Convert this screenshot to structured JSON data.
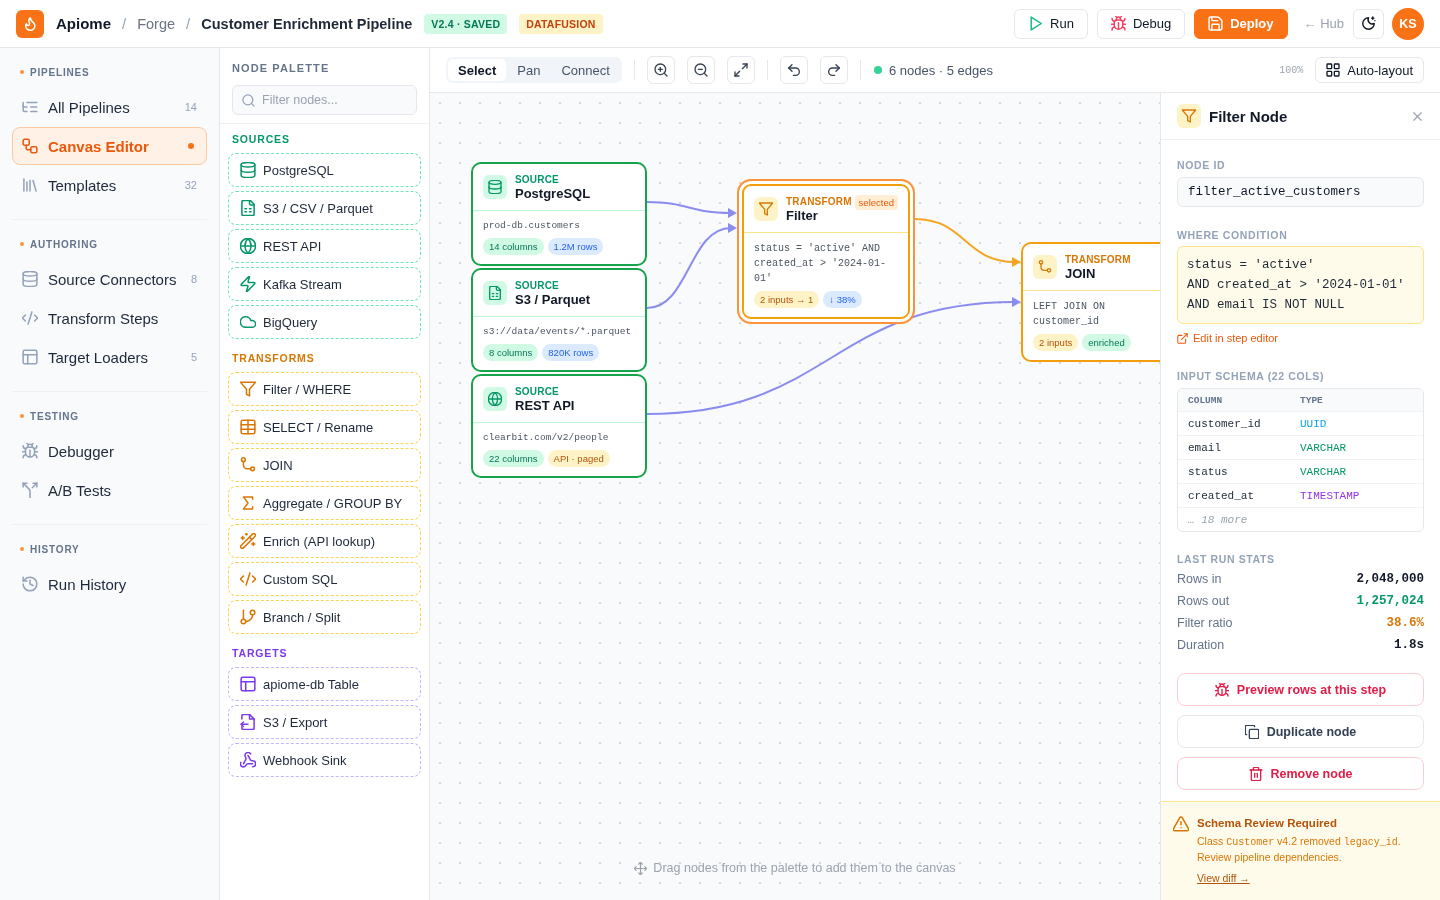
{
  "header": {
    "breadcrumb": [
      {
        "label": "Apiome"
      },
      {
        "separator": "/",
        "label": "Forge"
      },
      {
        "separator": "/",
        "label": "Customer Enrichment Pipeline"
      }
    ],
    "badges": [
      {
        "label": "V2.4 · SAVED",
        "kind": "success"
      },
      {
        "label": "DATAFUSION",
        "kind": "warning"
      }
    ],
    "actions": [
      {
        "label": "Run",
        "kind": "outline"
      },
      {
        "label": "Debug",
        "kind": "outline"
      },
      {
        "label": "Deploy",
        "kind": "primary"
      }
    ],
    "hub_link": "← Hub",
    "avatar": "KS"
  },
  "sidebar": {
    "sections": [
      {
        "title": "PIPELINES",
        "items": [
          {
            "label": "All Pipelines",
            "count": "14",
            "selected": false
          },
          {
            "label": "Canvas Editor",
            "selected": true
          },
          {
            "label": "Templates",
            "count": "32",
            "selected": false
          }
        ]
      },
      {
        "title": "AUTHORING",
        "items": [
          {
            "label": "Source Connectors",
            "count": "8",
            "selected": false
          },
          {
            "label": "Transform Steps",
            "selected": false
          },
          {
            "label": "Target Loaders",
            "count": "5",
            "selected": false
          }
        ]
      },
      {
        "title": "TESTING",
        "items": [
          {
            "label": "Debugger",
            "selected": false
          },
          {
            "label": "A/B Tests",
            "selected": false
          }
        ]
      },
      {
        "title": "HISTORY",
        "items": [
          {
            "label": "Run History",
            "selected": false
          }
        ]
      }
    ]
  },
  "palette": {
    "title": "NODE PALETTE",
    "search": {
      "placeholder": "Filter nodes..."
    },
    "groups": [
      {
        "title": "SOURCES",
        "kind": "source",
        "items": [
          "PostgreSQL",
          "S3 / CSV / Parquet",
          "REST API",
          "Kafka Stream",
          "BigQuery"
        ]
      },
      {
        "title": "TRANSFORMS",
        "kind": "transform",
        "items": [
          "Filter / WHERE",
          "SELECT / Rename",
          "JOIN",
          "Aggregate / GROUP BY",
          "Enrich (API lookup)",
          "Custom SQL",
          "Branch / Split"
        ]
      },
      {
        "title": "TARGETS",
        "kind": "target",
        "items": [
          "apiome-db Table",
          "S3 / Export",
          "Webhook Sink"
        ]
      }
    ]
  },
  "toolbar": {
    "modes": [
      {
        "label": "Select",
        "selected": true
      },
      {
        "label": "Pan",
        "selected": false
      },
      {
        "label": "Connect",
        "selected": false
      }
    ],
    "status": "6 nodes · 5 edges",
    "zoom": "100%",
    "auto_layout": "Auto-layout"
  },
  "canvas": {
    "nodes": [
      {
        "kind": "source",
        "type_label": "SOURCE",
        "title": "PostgreSQL",
        "detail": "prod-db.customers",
        "selected": false,
        "tags": [
          {
            "label": "14 columns",
            "kind": "success"
          },
          {
            "label": "1.2M rows",
            "kind": "info"
          }
        ]
      },
      {
        "kind": "source",
        "type_label": "SOURCE",
        "title": "S3 / Parquet",
        "detail": "s3://data/events/*.parquet",
        "selected": false,
        "tags": [
          {
            "label": "8 columns",
            "kind": "success"
          },
          {
            "label": "820K rows",
            "kind": "info"
          }
        ]
      },
      {
        "kind": "source",
        "type_label": "SOURCE",
        "title": "REST API",
        "detail": "clearbit.com/v2/people",
        "selected": false,
        "tags": [
          {
            "label": "22 columns",
            "kind": "success"
          },
          {
            "label": "API · paged",
            "kind": "warning"
          }
        ]
      },
      {
        "kind": "transform",
        "type_label": "TRANSFORM",
        "title": "Filter",
        "badge": "selected",
        "detail": "status = 'active' AND created_at > '2024-01-01'",
        "selected": true,
        "tags": [
          {
            "label": "2 inputs → 1",
            "kind": "warning"
          },
          {
            "label": "↓ 38%",
            "kind": "info"
          }
        ]
      },
      {
        "kind": "transform",
        "type_label": "TRANSFORM",
        "title": "JOIN",
        "detail": "LEFT JOIN ON customer_id",
        "selected": false,
        "tags": [
          {
            "label": "2 inputs",
            "kind": "warning"
          },
          {
            "label": "enriched",
            "kind": "success"
          }
        ]
      }
    ],
    "hint": "Drag nodes from the palette to add them to the canvas"
  },
  "inspector": {
    "title": "Filter Node",
    "node_id": {
      "label": "NODE ID",
      "value": "filter_active_customers"
    },
    "condition": {
      "label": "WHERE CONDITION",
      "value": "status = 'active'\nAND created_at > '2024-01-01'\nAND email IS NOT NULL"
    },
    "edit_link": "Edit in step editor",
    "schema": {
      "title": "INPUT SCHEMA (22 COLS)",
      "columns": [
        "COLUMN",
        "TYPE"
      ],
      "rows": [
        {
          "name": "customer_id",
          "type": "UUID",
          "color": "#0ea5e9"
        },
        {
          "name": "email",
          "type": "VARCHAR",
          "color": "#059669"
        },
        {
          "name": "status",
          "type": "VARCHAR",
          "color": "#059669"
        },
        {
          "name": "created_at",
          "type": "TIMESTAMP",
          "color": "#9333ea"
        }
      ],
      "more": "… 18 more"
    },
    "stats": {
      "title": "LAST RUN STATS",
      "rows": [
        {
          "label": "Rows in",
          "value": "2,048,000",
          "color": "#111827"
        },
        {
          "label": "Rows out",
          "value": "1,257,024",
          "color": "#059669"
        },
        {
          "label": "Filter ratio",
          "value": "38.6%",
          "color": "#d97706"
        },
        {
          "label": "Duration",
          "value": "1.8s",
          "color": "#111827"
        }
      ]
    },
    "actions": [
      {
        "label": "Preview rows at this step",
        "kind": "danger"
      },
      {
        "label": "Duplicate node",
        "kind": "neutral"
      },
      {
        "label": "Remove node",
        "kind": "danger"
      }
    ]
  },
  "alert": {
    "title": "Schema Review Required",
    "message": [
      {
        "text": "Class "
      },
      {
        "text": "Customer",
        "code": true
      },
      {
        "text": " v4.2 removed "
      },
      {
        "text": "legacy_id",
        "code": true
      },
      {
        "text": ". Review pipeline dependencies."
      }
    ],
    "link": "View diff →"
  }
}
